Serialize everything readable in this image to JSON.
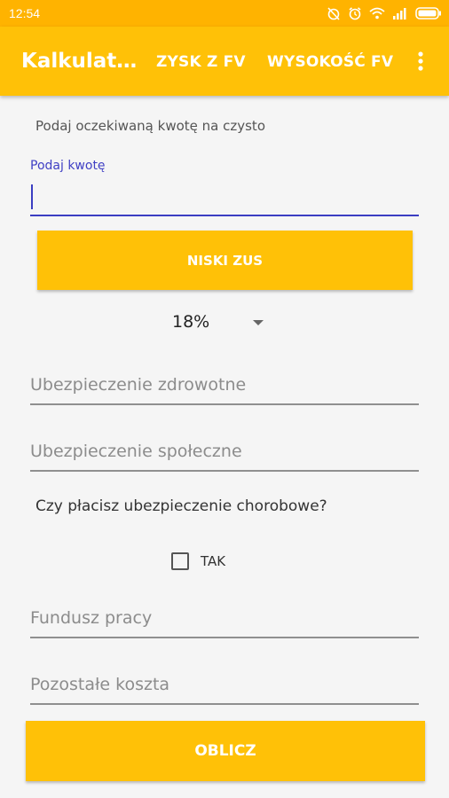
{
  "status_bar": {
    "time": "12:54",
    "icons": [
      "alarm-off-icon",
      "alarm-icon",
      "wifi-icon",
      "signal-icon",
      "battery-icon"
    ]
  },
  "app_bar": {
    "title": "Kalkulat…",
    "tabs": [
      {
        "label": "ZYSK Z FV"
      },
      {
        "label": "WYSOKOŚĆ FV"
      }
    ],
    "accent": "#ffc107"
  },
  "form": {
    "hint": "Podaj oczekiwaną kwotę na czysto",
    "amount_label": "Podaj kwotę",
    "amount_value": "",
    "zus_button": "NISKI ZUS",
    "tax_rate": "18%",
    "health_insurance_placeholder": "Ubezpieczenie zdrowotne",
    "social_insurance_placeholder": "Ubezpieczenie społeczne",
    "sickness_question": "Czy płacisz ubezpieczenie chorobowe?",
    "sickness_checkbox_label": "TAK",
    "sickness_checked": false,
    "labor_fund_placeholder": "Fundusz pracy",
    "other_costs_placeholder": "Pozostałe koszta",
    "calculate_button": "OBLICZ"
  }
}
